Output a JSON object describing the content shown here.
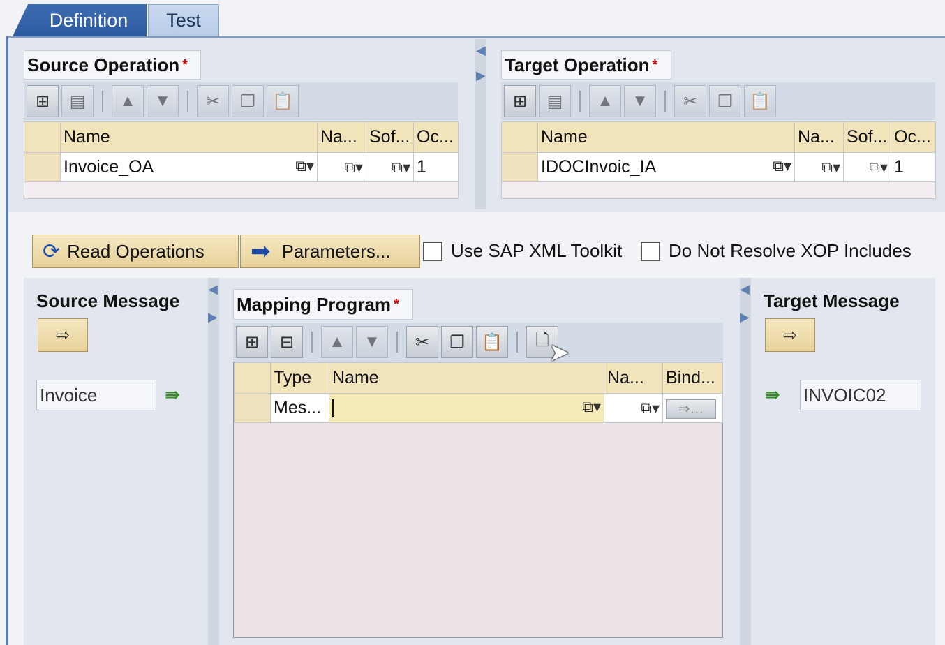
{
  "tabs": [
    {
      "label": "Definition"
    },
    {
      "label": "Test"
    }
  ],
  "source_operation": {
    "label": "Source Operation",
    "required": "*",
    "columns": [
      "Name",
      "Na...",
      "Sof...",
      "Oc..."
    ],
    "row": {
      "name": "Invoice_OA",
      "occurrence": "1"
    }
  },
  "target_operation": {
    "label": "Target Operation",
    "required": "*",
    "columns": [
      "Name",
      "Na...",
      "Sof...",
      "Oc..."
    ],
    "row": {
      "name": "IDOCInvoic_IA",
      "occurrence": "1"
    }
  },
  "actions": {
    "read_operations": "Read Operations",
    "parameters": "Parameters...",
    "use_sap_xml_toolkit": "Use SAP XML Toolkit",
    "do_not_resolve_xop": "Do Not Resolve XOP Includes"
  },
  "source_message": {
    "label": "Source Message",
    "value": "Invoice"
  },
  "target_message": {
    "label": "Target Message",
    "value": "INVOIC02"
  },
  "mapping_program": {
    "label": "Mapping Program",
    "required": "*",
    "columns": [
      "Type",
      "Name",
      "Na...",
      "Bind..."
    ],
    "row": {
      "type": "Mes...",
      "name": ""
    }
  },
  "icons": {
    "add": "add-row-icon",
    "delete": "delete-row-icon",
    "up": "move-up-icon",
    "down": "move-down-icon",
    "cut": "cut-icon",
    "copy": "copy-icon",
    "paste": "paste-icon",
    "new_doc": "new-document-icon"
  },
  "colors": {
    "tab_active": "#2e5b9f",
    "header_cell": "#f2e4ba",
    "required": "#d10000"
  }
}
